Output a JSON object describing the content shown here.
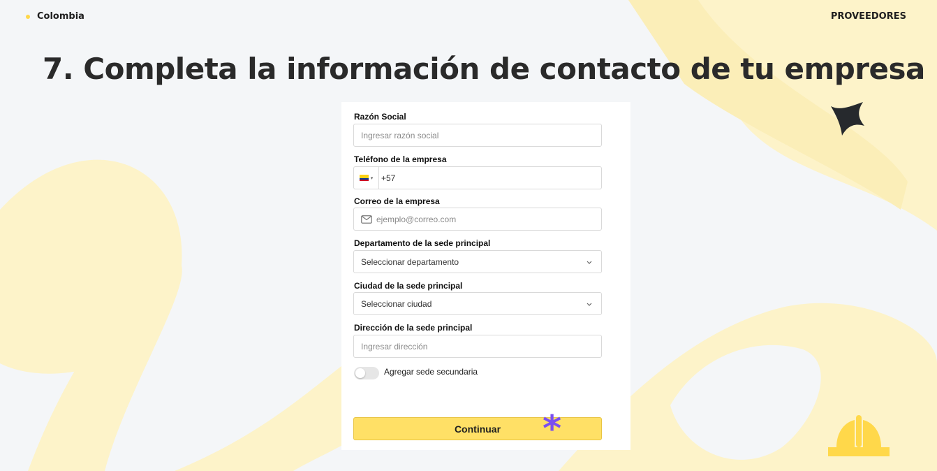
{
  "header": {
    "country": "Colombia",
    "section": "PROVEEDORES"
  },
  "page": {
    "title": "7. Completa la información de contacto de tu empresa"
  },
  "form": {
    "razon_social": {
      "label": "Razón Social",
      "placeholder": "Ingresar razón social"
    },
    "telefono": {
      "label": "Teléfono de la empresa",
      "country_code": "+57",
      "flag": "colombia-flag"
    },
    "correo": {
      "label": "Correo de la empresa",
      "placeholder": "ejemplo@correo.com"
    },
    "departamento": {
      "label": "Departamento de la sede principal",
      "selected": "Seleccionar departamento"
    },
    "ciudad": {
      "label": "Ciudad de la sede principal",
      "selected": "Seleccionar ciudad"
    },
    "direccion": {
      "label": "Dirección de la sede principal",
      "placeholder": "Ingresar dirección"
    },
    "sede_secundaria": {
      "label": "Agregar sede secundaria",
      "enabled": false
    },
    "submit_label": "Continuar"
  },
  "decor": {
    "asterisk": "*",
    "accent_color": "#ffe066",
    "asterisk_color": "#7b4ff0",
    "background_shape_color": "#fdf3c9"
  }
}
